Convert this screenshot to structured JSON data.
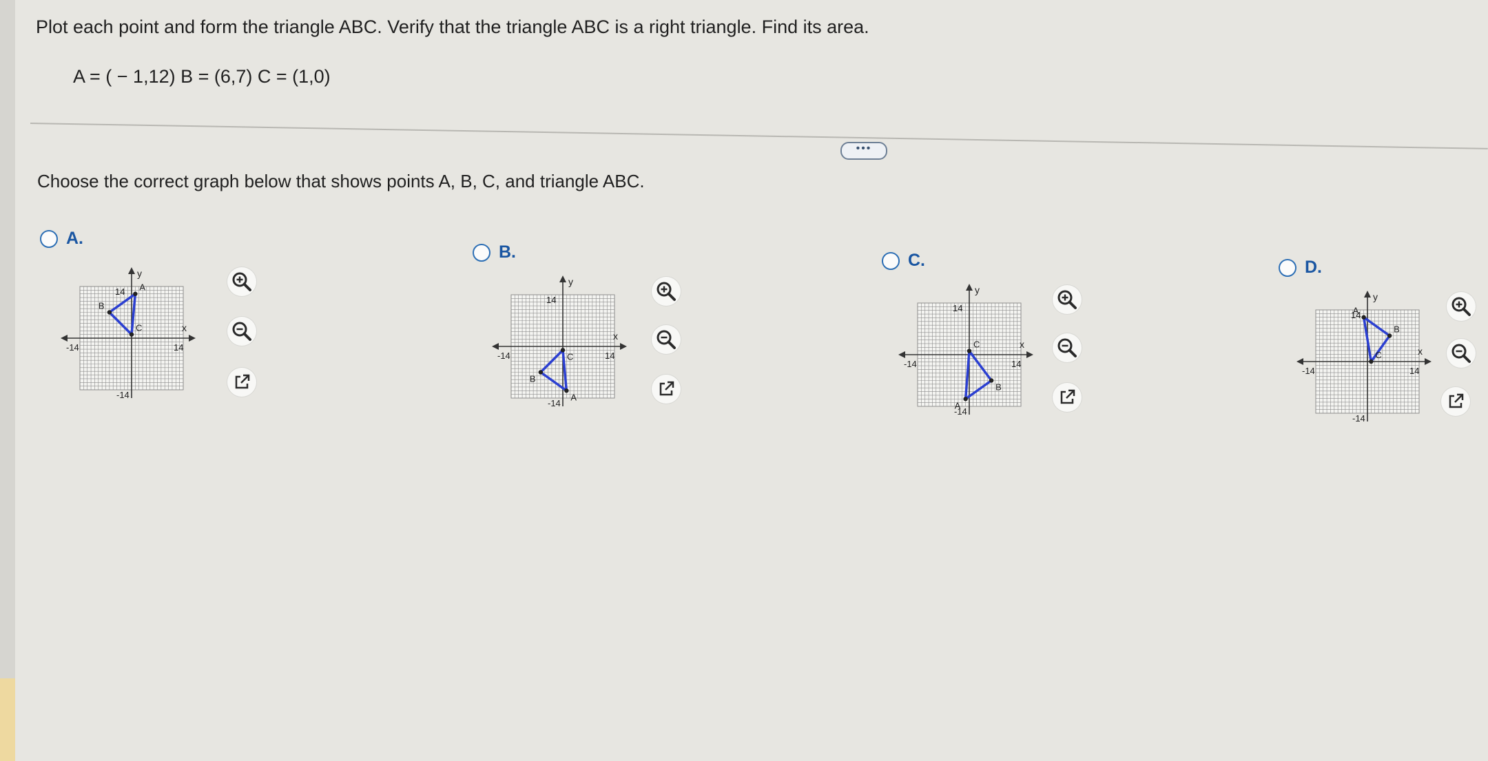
{
  "question": {
    "prompt": "Plot each point and form the triangle ABC.  Verify that the triangle ABC is a right triangle.  Find its area.",
    "points_text": "A = ( − 1,12)  B = (6,7)  C = (1,0)"
  },
  "instruction": "Choose the correct graph below that shows points A, B, C, and triangle ABC.",
  "more_button_label": "•••",
  "graph_common": {
    "axis_min": -14,
    "axis_max": 14,
    "tick_min_label": "-14",
    "tick_max_label": "14",
    "x_axis_label": "x",
    "y_axis_label": "y",
    "triangle_color": "#2b3fd1",
    "grid_color": "#8c8c8c",
    "axis_color": "#333333"
  },
  "options": [
    {
      "label": "A.",
      "vertices": [
        {
          "name": "A",
          "x": 1,
          "y": 12
        },
        {
          "name": "B",
          "x": -6,
          "y": 7
        },
        {
          "name": "C",
          "x": 0,
          "y": 1
        }
      ]
    },
    {
      "label": "B.",
      "vertices": [
        {
          "name": "A",
          "x": 1,
          "y": -12
        },
        {
          "name": "B",
          "x": -6,
          "y": -7
        },
        {
          "name": "C",
          "x": 0,
          "y": -1
        }
      ]
    },
    {
      "label": "C.",
      "vertices": [
        {
          "name": "A",
          "x": -1,
          "y": -12
        },
        {
          "name": "B",
          "x": 6,
          "y": -7
        },
        {
          "name": "C",
          "x": 0,
          "y": 1
        }
      ]
    },
    {
      "label": "D.",
      "vertices": [
        {
          "name": "A",
          "x": -1,
          "y": 12
        },
        {
          "name": "B",
          "x": 6,
          "y": 7
        },
        {
          "name": "C",
          "x": 1,
          "y": 0
        }
      ]
    }
  ],
  "tool_icons": [
    "zoom-in-icon",
    "zoom-out-icon",
    "open-new-window-icon"
  ]
}
